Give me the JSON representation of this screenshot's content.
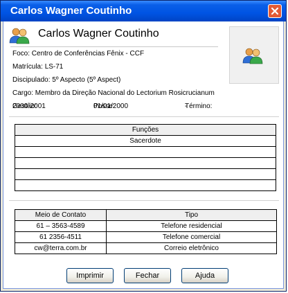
{
  "window": {
    "title": "Carlos Wagner Coutinho"
  },
  "header": {
    "name": "Carlos Wagner Coutinho"
  },
  "info": {
    "foco_label": "Foco:",
    "foco_value": "Centro de Conferências Fênix - CCF",
    "matricula_label": "Matrícula:",
    "matricula_value": "LS-71",
    "discipulado_label": "Discipulado:",
    "discipulado_value": "5º Aspecto (5º Aspect)",
    "cargo_label": "Cargo:",
    "cargo_value": "Membro da Direção Nacional do Lectorium Rosicrucianum",
    "gestao_label": "Gestão:",
    "gestao_value": "2000-2001",
    "posse_label": "Posse:",
    "posse_value": "01/01/2000",
    "termino_label": "Término:",
    "termino_value": "-"
  },
  "funcoes": {
    "header": "Funções",
    "rows": [
      "Sacerdote",
      "",
      "",
      "",
      ""
    ]
  },
  "contatos": {
    "col_meio": "Meio de Contato",
    "col_tipo": "Tipo",
    "rows": [
      {
        "meio": "61 – 3563-4589",
        "tipo": "Telefone residencial"
      },
      {
        "meio": "61 2356-4511",
        "tipo": "Telefone comercial"
      },
      {
        "meio": "cw@terra.com.br",
        "tipo": "Correio eletrônico"
      }
    ]
  },
  "buttons": {
    "print": "Imprimir",
    "close": "Fechar",
    "help": "Ajuda"
  },
  "icons": {
    "title_close": "close-icon",
    "header": "users-icon",
    "photo": "users-icon"
  },
  "colors": {
    "titlebar": "#0054e3",
    "close_button": "#e35b35"
  }
}
